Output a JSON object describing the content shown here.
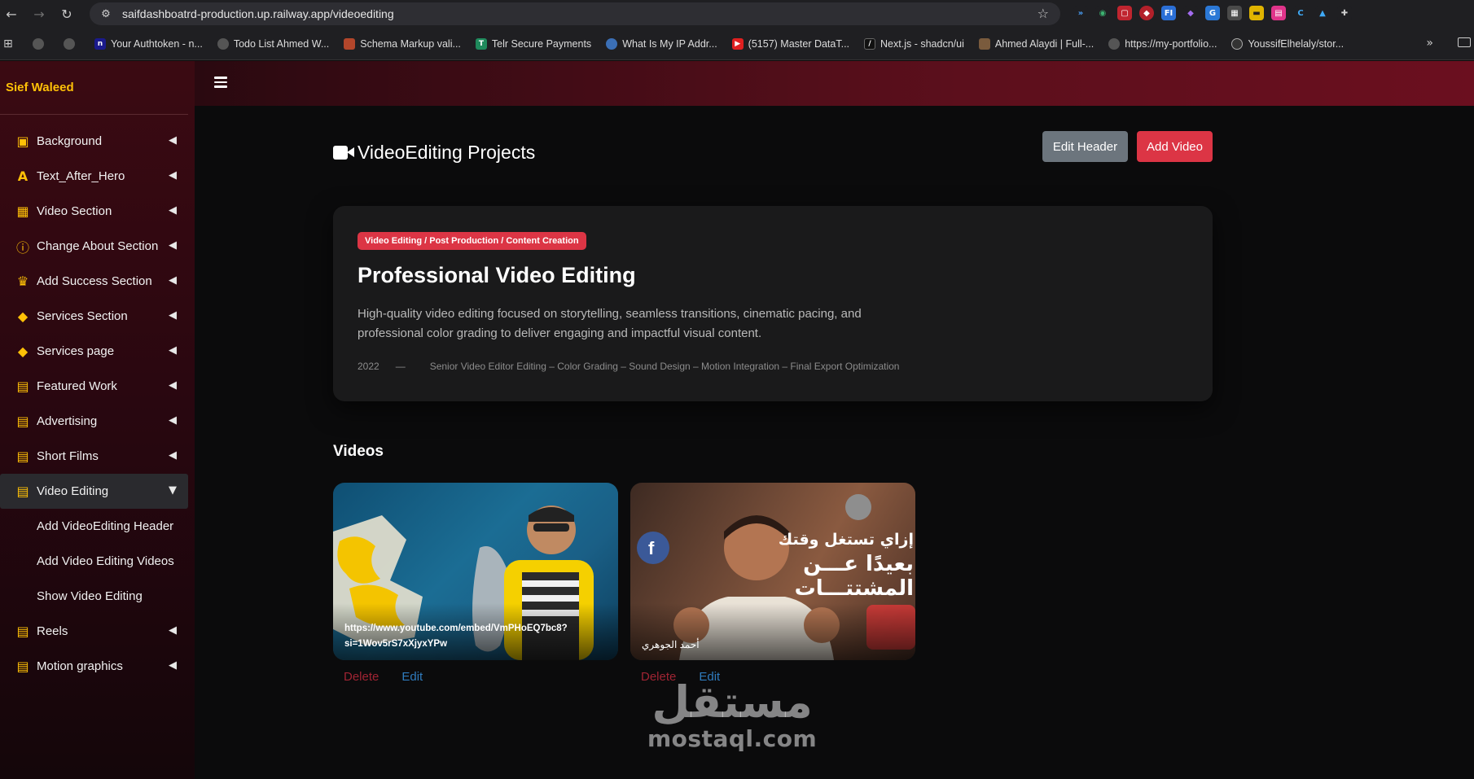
{
  "browser": {
    "url": "saifdashboatrd-production.up.railway.app/videoediting",
    "bookmarks": [
      {
        "label": "",
        "color": "#555"
      },
      {
        "label": "",
        "color": "#555"
      },
      {
        "label": "Your Authtoken - n...",
        "color": "#1a1a8c",
        "glyph": "n"
      },
      {
        "label": "Todo List Ahmed W...",
        "color": "#555"
      },
      {
        "label": "Schema Markup vali...",
        "color": "#b3462b"
      },
      {
        "label": "Telr Secure Payments",
        "color": "#1f8a5c",
        "glyph": "T"
      },
      {
        "label": "What Is My IP Addr...",
        "color": "#3b6fb6"
      },
      {
        "label": "(5157) Master DataT...",
        "color": "#e02020",
        "glyph": "▶"
      },
      {
        "label": "Next.js - shadcn/ui",
        "color": "#111"
      },
      {
        "label": "Ahmed Alaydi | Full-...",
        "color": "#7a5b3d"
      },
      {
        "label": "https://my-portfolio...",
        "color": "#555"
      },
      {
        "label": "YoussifElhelaly/stor...",
        "color": "#333"
      }
    ]
  },
  "sidebar": {
    "brand": "Sief Waleed",
    "items": [
      {
        "label": "Background",
        "icon": "image-icon",
        "glyph": "▣"
      },
      {
        "label": "Text_After_Hero",
        "icon": "font-icon",
        "glyph": "A"
      },
      {
        "label": "Video Section",
        "icon": "film-icon",
        "glyph": "▦"
      },
      {
        "label": "Change About Section",
        "icon": "info-circle-icon",
        "glyph": "ⓘ"
      },
      {
        "label": "Add Success Section",
        "icon": "trophy-icon",
        "glyph": "♛"
      },
      {
        "label": "Services Section",
        "icon": "tags-icon",
        "glyph": "◆"
      },
      {
        "label": "Services page",
        "icon": "tags-icon",
        "glyph": "◆"
      },
      {
        "label": "Featured Work",
        "icon": "clipboard-icon",
        "glyph": "▤"
      },
      {
        "label": "Advertising",
        "icon": "clipboard-icon",
        "glyph": "▤"
      },
      {
        "label": "Short Films",
        "icon": "clipboard-icon",
        "glyph": "▤"
      },
      {
        "label": "Video Editing",
        "icon": "clipboard-icon",
        "glyph": "▤"
      }
    ],
    "subitems": [
      "Add VideoEditing Header",
      "Add Video Editing Videos",
      "Show Video Editing"
    ],
    "items_after": [
      {
        "label": "Reels",
        "icon": "clipboard-icon",
        "glyph": "▤"
      },
      {
        "label": "Motion graphics",
        "icon": "clipboard-icon",
        "glyph": "▤"
      }
    ]
  },
  "page": {
    "title": "VideoEditing Projects",
    "edit_header_label": "Edit Header",
    "add_video_label": "Add Video"
  },
  "hero": {
    "badge": "Video Editing / Post Production / Content Creation",
    "title": "Professional Video Editing",
    "description": "High-quality video editing focused on storytelling, seamless transitions, cinematic pacing, and professional color grading to deliver engaging and impactful visual content.",
    "year": "2022",
    "separator": "—",
    "role": "Senior Video Editor Editing – Color Grading – Sound Design – Motion Integration – Final Export Optimization"
  },
  "videos": {
    "heading": "Videos",
    "items": [
      {
        "caption": "https://www.youtube.com/embed/VmPHoEQ7bc8?si=1Wov5rS7xXjyxYPw",
        "delete_label": "Delete",
        "edit_label": "Edit"
      },
      {
        "caption": "أحمد الجوهري",
        "title_line1": "إزاي تستغل وقتك",
        "title_line2": "بعيدًا عـــن",
        "title_line3": "المشتتـــات",
        "delete_label": "Delete",
        "edit_label": "Edit"
      }
    ]
  },
  "watermark": {
    "arabic": "مستقل",
    "latin": "mostaql.com"
  },
  "colors": {
    "accent_red": "#dc3545",
    "brand_yellow": "#ffc107",
    "secondary_gray": "#6c757d"
  }
}
